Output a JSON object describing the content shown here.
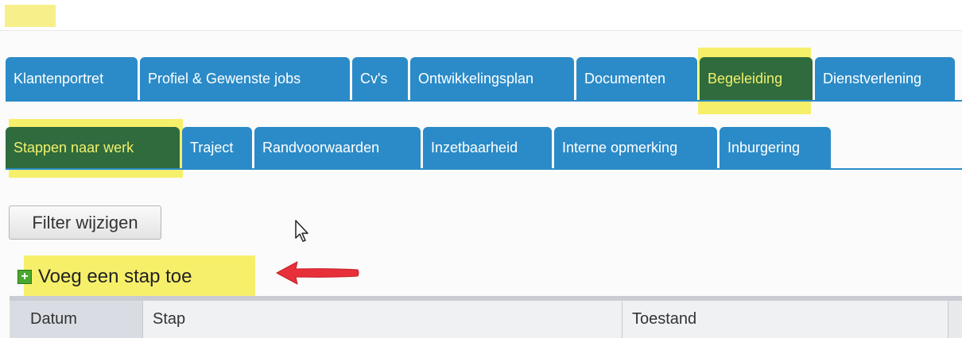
{
  "main_tabs": [
    "Klantenportret",
    "Profiel & Gewenste jobs",
    "Cv's",
    "Ontwikkelingsplan",
    "Documenten",
    "Begeleiding",
    "Dienstverlening"
  ],
  "main_tab_active": "Begeleiding",
  "sub_tabs": [
    "Stappen naar werk",
    "Traject",
    "Randvoorwaarden",
    "Inzetbaarheid",
    "Interne opmerking",
    "Inburgering"
  ],
  "sub_tab_active": "Stappen naar werk",
  "filter_button_label": "Filter wijzigen",
  "add_step_label": "Voeg een stap toe",
  "table_headers": [
    "Datum",
    "Stap",
    "Toestand"
  ],
  "colors": {
    "tab_blue": "#2b8bc8",
    "tab_active_bg": "#2f6b3c",
    "tab_active_text": "#f1f06e",
    "highlight_yellow": "#f5ec50",
    "annotation_arrow": "#e8303a"
  },
  "icons": {
    "add": "plus-icon",
    "pointer": "mouse-pointer-icon",
    "annotation": "red-arrow-icon"
  }
}
